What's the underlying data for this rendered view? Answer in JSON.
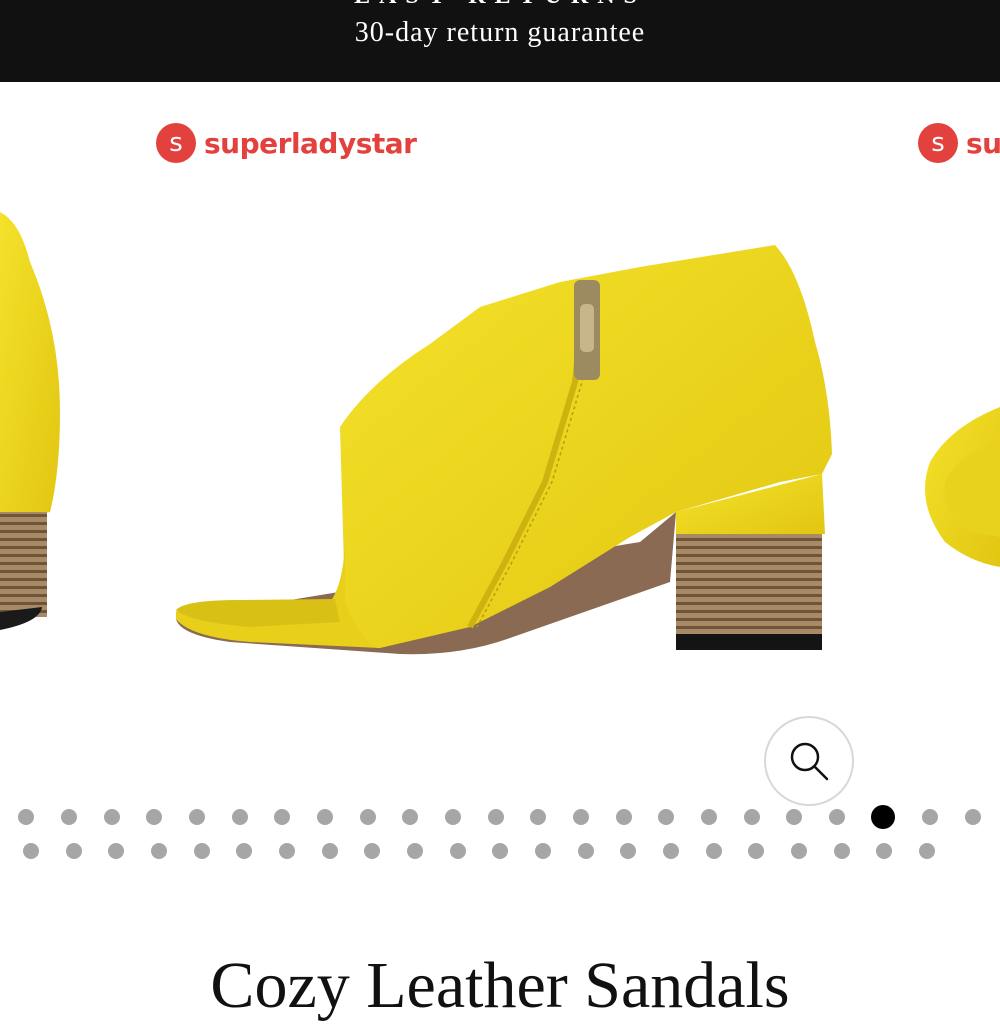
{
  "banner": {
    "title": "EASY RETURNS",
    "subtitle": "30-day return guarantee"
  },
  "gallery": {
    "brand_name": "superladystar",
    "brand_name_partial": "sup",
    "star_glyph": "s",
    "product_color": "#f0dc1c",
    "brand_color": "#e3413d",
    "image_count": 45,
    "active_index": 20
  },
  "zoom": {
    "icon": "magnifier-icon"
  },
  "product": {
    "title": "Cozy Leather Sandals"
  }
}
